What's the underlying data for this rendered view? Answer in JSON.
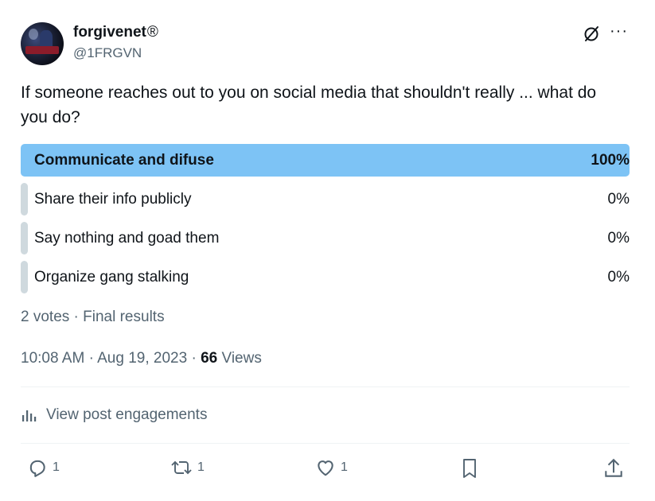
{
  "author": {
    "display_name": "forgivenet",
    "badge": "®",
    "handle": "@1FRGVN"
  },
  "icons": [
    "grok-icon",
    "more-icon",
    "analytics-icon",
    "reply-icon",
    "retweet-icon",
    "like-icon",
    "bookmark-icon",
    "share-icon"
  ],
  "tweet": {
    "text": "If someone reaches out to you on social media that shouldn't really ... what do you do?"
  },
  "poll": {
    "options": [
      {
        "label": "Communicate and difuse",
        "percent": "100%",
        "value": 100
      },
      {
        "label": "Share their info publicly",
        "percent": "0%",
        "value": 0
      },
      {
        "label": "Say nothing and goad them",
        "percent": "0%",
        "value": 0
      },
      {
        "label": "Organize gang stalking",
        "percent": "0%",
        "value": 0
      }
    ],
    "summary": "2 votes · Final results"
  },
  "timestamp": {
    "time": "10:08 AM",
    "date": "Aug 19, 2023",
    "views_count": "66",
    "views_label": "Views"
  },
  "engagements_link": "View post engagements",
  "actions": {
    "reply_count": "1",
    "retweet_count": "1",
    "like_count": "1"
  },
  "colors": {
    "winner_bar": "#7dc3f5",
    "loser_bar": "#cfd9de",
    "muted_text": "#536471"
  }
}
